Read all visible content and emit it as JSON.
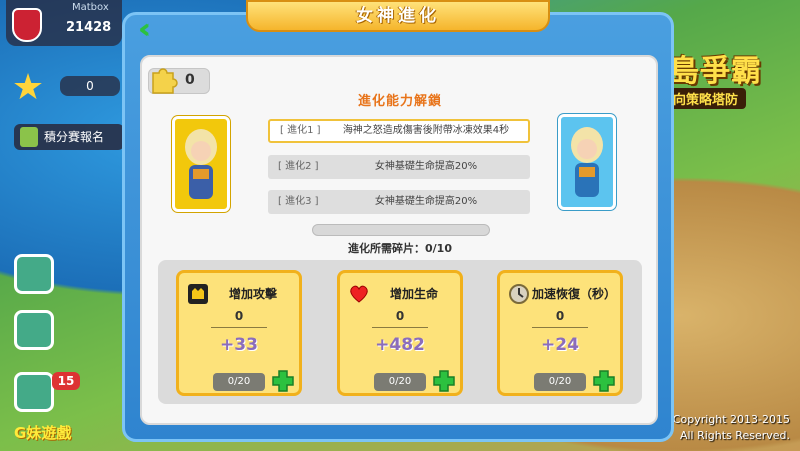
{
  "hud": {
    "player_name": "Matbox",
    "gold": "21428",
    "counter": "0",
    "rank_button": "積分賽報名",
    "badge": "15",
    "brand": "G妹遊戲",
    "copyright_line1": "Copyright 2013-2015",
    "copyright_line2": "All Rights Reserved."
  },
  "game_logo": {
    "title": "海島爭霸",
    "subtitle": "反向策略塔防"
  },
  "panel": {
    "title": "女神進化",
    "back_icon": "double-chevron-left-icon",
    "shard_count": "0",
    "heading": "進化能力解鎖",
    "evolutions": [
      {
        "tag": "[ 進化1 ]",
        "desc": "海神之怒造成傷害後附帶冰凍效果4秒"
      },
      {
        "tag": "[ 進化2 ]",
        "desc": "女神基礎生命提高20%"
      },
      {
        "tag": "[ 進化3 ]",
        "desc": "女神基礎生命提高20%"
      }
    ],
    "progress_label": "進化所需碎片：0/10",
    "progress_fraction": 0,
    "stats": [
      {
        "name": "增加攻擊",
        "value": "0",
        "bonus": "+33",
        "ratio": "0/20",
        "icon": "attack-icon"
      },
      {
        "name": "增加生命",
        "value": "0",
        "bonus": "+482",
        "ratio": "0/20",
        "icon": "heart-icon"
      },
      {
        "name": "加速恢復（秒）",
        "value": "0",
        "bonus": "+24",
        "ratio": "0/20",
        "icon": "clock-icon"
      }
    ]
  },
  "colors": {
    "accent_orange": "#e8741a",
    "plus_green": "#2cc13f",
    "bonus_purple": "#8b6dbc",
    "card_gold": "#fde27a"
  }
}
